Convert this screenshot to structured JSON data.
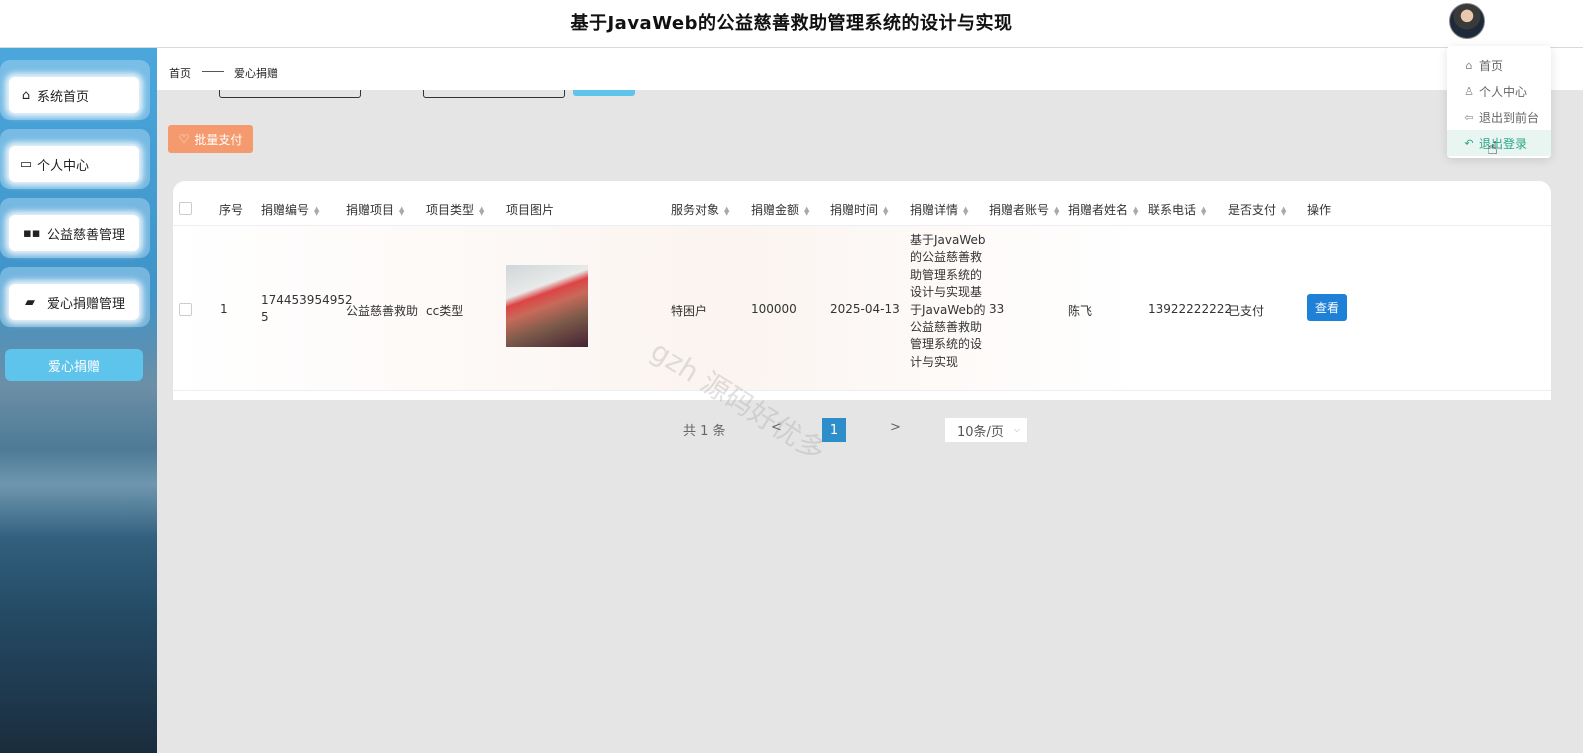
{
  "header": {
    "title": "基于JavaWeb的公益慈善救助管理系统的设计与实现"
  },
  "sidebar": {
    "items": [
      {
        "label": "系统首页",
        "icon": "home-icon"
      },
      {
        "label": "个人中心",
        "icon": "user-card-icon"
      },
      {
        "label": "公益慈善管理",
        "icon": "grid-icon"
      },
      {
        "label": "爱心捐赠管理",
        "icon": "wallet-icon"
      }
    ],
    "active": "爱心捐赠"
  },
  "breadcrumb": {
    "home": "首页",
    "current": "爱心捐赠"
  },
  "toolbar": {
    "batch_pay": "批量支付"
  },
  "table": {
    "headers": [
      "序号",
      "捐赠编号",
      "捐赠项目",
      "项目类型",
      "项目图片",
      "服务对象",
      "捐赠金额",
      "捐赠时间",
      "捐赠详情",
      "捐赠者账号",
      "捐赠者姓名",
      "联系电话",
      "是否支付",
      "操作"
    ],
    "rows": [
      {
        "index": "1",
        "donation_no_line1": "174453954952",
        "donation_no_line2": "5",
        "project": "公益慈善救助",
        "type": "cc类型",
        "target": "特困户",
        "amount": "100000",
        "time": "2025-04-13",
        "detail_lines": [
          "基于JavaWeb",
          "的公益慈善救",
          "助管理系统的",
          "设计与实现基",
          "于JavaWeb的",
          "公益慈善救助",
          "管理系统的设",
          "计与实现"
        ],
        "account": "33",
        "name": "陈飞",
        "phone": "13922222222",
        "paid": "已支付",
        "action": "查看"
      }
    ]
  },
  "pagination": {
    "total": "共 1 条",
    "prev": "<",
    "current": "1",
    "next": ">",
    "page_size": "10条/页"
  },
  "user_menu": {
    "items": [
      {
        "label": "首页",
        "icon": "home-icon"
      },
      {
        "label": "个人中心",
        "icon": "user-icon"
      },
      {
        "label": "退出到前台",
        "icon": "back-arrow-icon"
      },
      {
        "label": "退出登录",
        "icon": "logout-icon"
      }
    ]
  },
  "watermark": "gzh 源码好优多",
  "colors": {
    "accent": "#5fc4ec",
    "batch_pay": "#f59a6e",
    "view_button": "#1e80d6",
    "page_active": "#2d8ec9",
    "menu_highlight": "#2aa889"
  }
}
